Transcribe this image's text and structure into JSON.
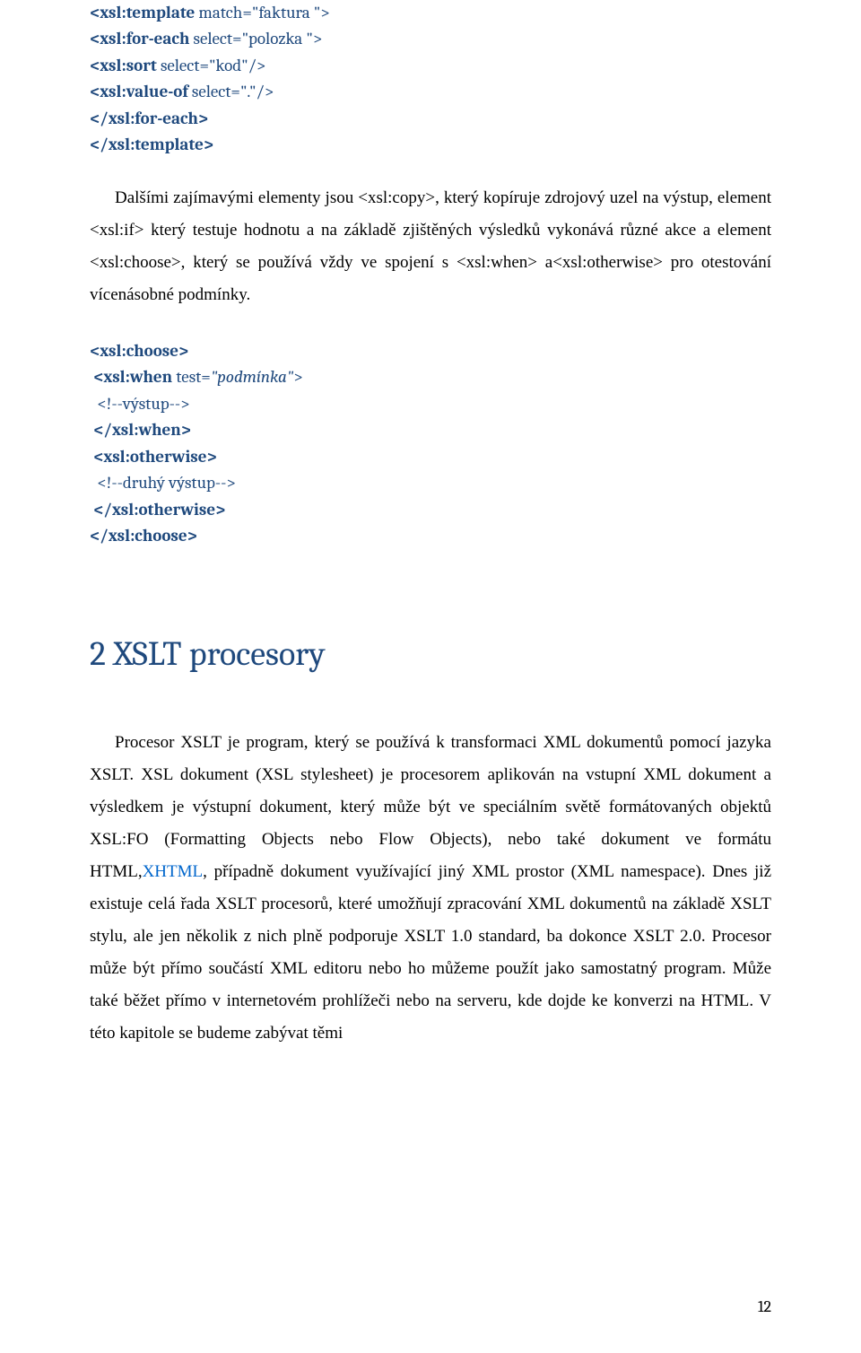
{
  "code1": {
    "l1_a": "<xsl:template",
    "l1_b": " match=\"faktura \">",
    "l2_a": "<xsl:for-each",
    "l2_b": " select=\"polozka \">",
    "l3_a": "<xsl:sort",
    "l3_b": " select=\"kod\"/>",
    "l4_a": "<xsl:value-of",
    "l4_b": " select=\".\"/>",
    "l5": "</xsl:for-each>",
    "l6": "</xsl:template>"
  },
  "para1": "Dalšími zajímavými elementy jsou <xsl:copy>, který kopíruje zdrojový uzel na výstup, element <xsl:if> který testuje hodnotu a na základě zjištěných výsledků vykonává různé akce a element <xsl:choose>, který se používá vždy ve spojení s <xsl:when> a<xsl:otherwise> pro otestování vícenásobné podmínky.",
  "code2": {
    "l1": "<xsl:choose>",
    "l2_a": " <xsl:when",
    "l2_b": " test=",
    "l2_c": "\"podmínka\"",
    "l2_d": ">",
    "l3": "  <!--výstup-->",
    "l4": " </xsl:when>",
    "l5": " <xsl:otherwise>",
    "l6": "  <!--druhý výstup-->",
    "l7": " </xsl:otherwise>",
    "l8": "</xsl:choose>"
  },
  "heading": "2 XSLT procesory",
  "para2_a": "Procesor XSLT je program, který se používá k transformaci XML dokumentů pomocí jazyka XSLT. XSL dokument (XSL stylesheet) je procesorem aplikován na vstupní XML dokument a výsledkem je výstupní dokument, který může být ve speciálním světě formátovaných objektů XSL:FO (Formatting Objects nebo Flow Objects), nebo také dokument ve formátu HTML,",
  "para2_link": "XHTML",
  "para2_b": ", případně dokument využívající jiný XML prostor (XML namespace). Dnes již existuje celá řada XSLT procesorů, které umožňují zpracování XML dokumentů na základě XSLT stylu, ale jen několik z nich plně podporuje XSLT 1.0 standard, ba dokonce XSLT 2.0. Procesor může být přímo součástí  XML editoru nebo ho můžeme použít jako samostatný program. Může také běžet přímo v internetovém prohlížeči nebo na serveru, kde dojde ke konverzi na HTML. V této kapitole se budeme zabývat těmi",
  "page_number": "12"
}
